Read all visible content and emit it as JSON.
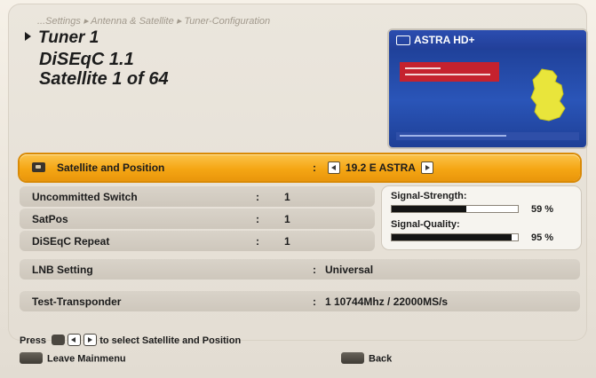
{
  "breadcrumb": "...Settings ▸ Antenna & Satellite ▸ Tuner-Configuration",
  "header": {
    "tuner": "Tuner 1",
    "diseqc": "DiSEqC 1.1",
    "satellite": "Satellite 1 of 64"
  },
  "preview": {
    "channel": "ASTRA HD+"
  },
  "menu": {
    "satellite_position": {
      "label": "Satellite and Position",
      "colon": ":",
      "value": "19.2 E ASTRA"
    },
    "uncommitted_switch": {
      "label": "Uncommitted Switch",
      "colon": ":",
      "value": "1"
    },
    "satpos": {
      "label": "SatPos",
      "colon": ":",
      "value": "1"
    },
    "diseqc_repeat": {
      "label": "DiSEqC Repeat",
      "colon": ":",
      "value": "1"
    },
    "lnb_setting": {
      "label": "LNB Setting",
      "colon": ":",
      "value": "Universal"
    },
    "test_transponder": {
      "label": "Test-Transponder",
      "colon": ":",
      "value": "1  10744Mhz / 22000MS/s"
    }
  },
  "signal": {
    "strength_label": "Signal-Strength:",
    "strength_value": "59 %",
    "strength_level": 59,
    "quality_label": "Signal-Quality:",
    "quality_value": "95 %",
    "quality_level": 95
  },
  "help": {
    "prefix": "Press",
    "suffix": "to select Satellite and Position"
  },
  "footer": {
    "leave": "Leave Mainmenu",
    "back": "Back"
  },
  "colors": {
    "highlight": "#f5a614",
    "preview_blue": "#2a55b8",
    "preview_red": "#c5222e"
  }
}
